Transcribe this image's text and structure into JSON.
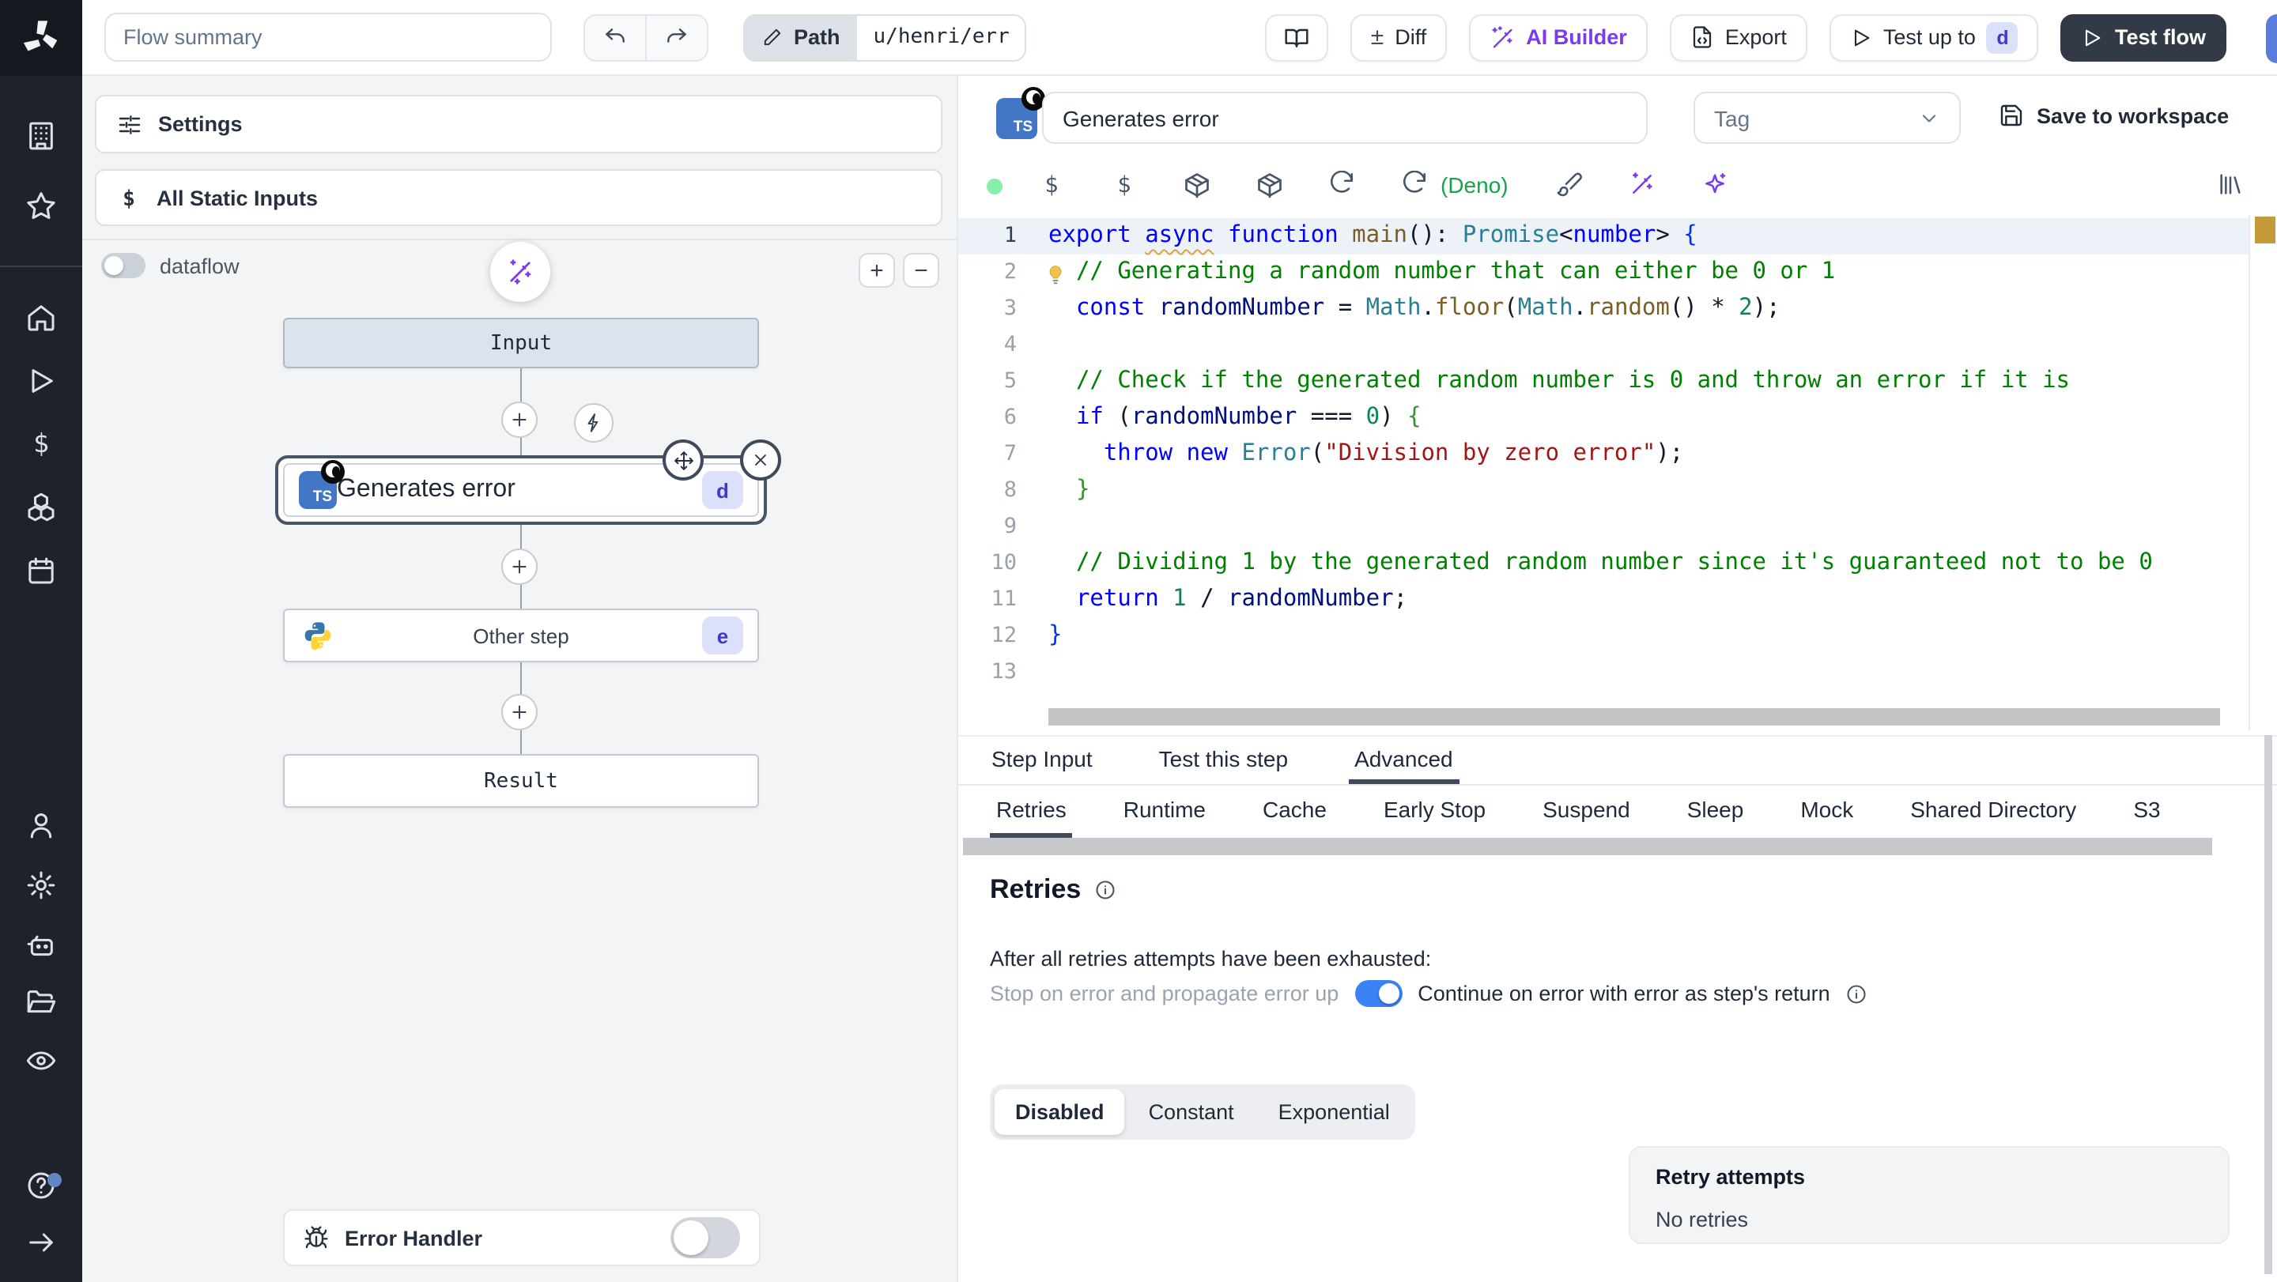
{
  "topbar": {
    "flow_summary_placeholder": "Flow summary",
    "path_label": "Path",
    "path_value": "u/henri/err",
    "diff_label": "Diff",
    "plusminus": "±",
    "ai_builder_label": "AI Builder",
    "export_label": "Export",
    "test_up_to_label": "Test up to",
    "test_badge": "d",
    "test_flow_label": "Test flow"
  },
  "flow": {
    "settings_label": "Settings",
    "static_inputs_label": "All Static Inputs",
    "dataflow_label": "dataflow",
    "zoom_in": "+",
    "zoom_out": "−",
    "input_label": "Input",
    "step1_label": "Generates error",
    "step1_badge": "d",
    "step2_label": "Other step",
    "step2_badge": "e",
    "result_label": "Result",
    "error_handler_label": "Error Handler"
  },
  "editor_header": {
    "step_name": "Generates error",
    "tag_placeholder": "Tag",
    "save_label": "Save to workspace",
    "deno_label": "(Deno)",
    "ts_label": "TS"
  },
  "editor": {
    "code": {
      "active_line": 1,
      "bulb_line": 2,
      "lines": [
        [
          [
            "kw",
            "export "
          ],
          [
            "kwu",
            "async"
          ],
          [
            "kw",
            " function "
          ],
          [
            "fn",
            "main"
          ],
          [
            "pl",
            "(): "
          ],
          [
            "typ",
            "Promise"
          ],
          [
            "pl",
            "<"
          ],
          [
            "kw",
            "number"
          ],
          [
            "pl",
            "> "
          ],
          [
            "brb",
            "{"
          ]
        ],
        [
          [
            "pl",
            "  "
          ],
          [
            "com",
            "// Generating a random number that can either be 0 or 1"
          ]
        ],
        [
          [
            "pl",
            "  "
          ],
          [
            "kw",
            "const "
          ],
          [
            "var",
            "randomNumber"
          ],
          [
            "pl",
            " = "
          ],
          [
            "typ",
            "Math"
          ],
          [
            "pl",
            "."
          ],
          [
            "fn",
            "floor"
          ],
          [
            "pl",
            "("
          ],
          [
            "typ",
            "Math"
          ],
          [
            "pl",
            "."
          ],
          [
            "fn",
            "random"
          ],
          [
            "pl",
            "() * "
          ],
          [
            "num",
            "2"
          ],
          [
            "pl",
            ");"
          ]
        ],
        [],
        [
          [
            "pl",
            "  "
          ],
          [
            "com",
            "// Check if the generated random number is 0 and throw an error if it is"
          ]
        ],
        [
          [
            "pl",
            "  "
          ],
          [
            "kw",
            "if "
          ],
          [
            "pl",
            "("
          ],
          [
            "var",
            "randomNumber"
          ],
          [
            "pl",
            " === "
          ],
          [
            "num",
            "0"
          ],
          [
            "pl",
            ") "
          ],
          [
            "brg",
            "{"
          ]
        ],
        [
          [
            "pl",
            "    "
          ],
          [
            "kw",
            "throw new "
          ],
          [
            "typ",
            "Error"
          ],
          [
            "pl",
            "("
          ],
          [
            "str",
            "\"Division by zero error\""
          ],
          [
            "pl",
            ");"
          ]
        ],
        [
          [
            "pl",
            "  "
          ],
          [
            "brg",
            "}"
          ]
        ],
        [],
        [
          [
            "pl",
            "  "
          ],
          [
            "com",
            "// Dividing 1 by the generated random number since it's guaranteed not to be 0"
          ]
        ],
        [
          [
            "pl",
            "  "
          ],
          [
            "kw",
            "return "
          ],
          [
            "num",
            "1"
          ],
          [
            "pl",
            " / "
          ],
          [
            "var",
            "randomNumber"
          ],
          [
            "pl",
            ";"
          ]
        ],
        [
          [
            "brb",
            "}"
          ]
        ],
        []
      ]
    }
  },
  "tabs": {
    "main": [
      "Step Input",
      "Test this step",
      "Advanced"
    ],
    "active_main": "Advanced",
    "sub": [
      "Retries",
      "Runtime",
      "Cache",
      "Early Stop",
      "Suspend",
      "Sleep",
      "Mock",
      "Shared Directory",
      "S3"
    ],
    "active_sub": "Retries"
  },
  "retries": {
    "title": "Retries",
    "exhausted_text": "After all retries attempts have been exhausted:",
    "stop_label": "Stop on error and propagate error up",
    "continue_label": "Continue on error with error as step's return",
    "modes": [
      "Disabled",
      "Constant",
      "Exponential"
    ],
    "active_mode": "Disabled",
    "attempts_label": "Retry attempts",
    "attempts_value": "No retries"
  },
  "colors": {
    "accent_blue": "#3b82f6",
    "purple": "#7c3aed",
    "ts_blue": "#4277c5",
    "badge_bg": "#dbe0fb",
    "badge_text": "#4338ca",
    "deno_green": "#16a34a",
    "warn_marker": "#c49a38",
    "dark_button": "#333a47",
    "sidebar_bg": "#1d222b"
  }
}
